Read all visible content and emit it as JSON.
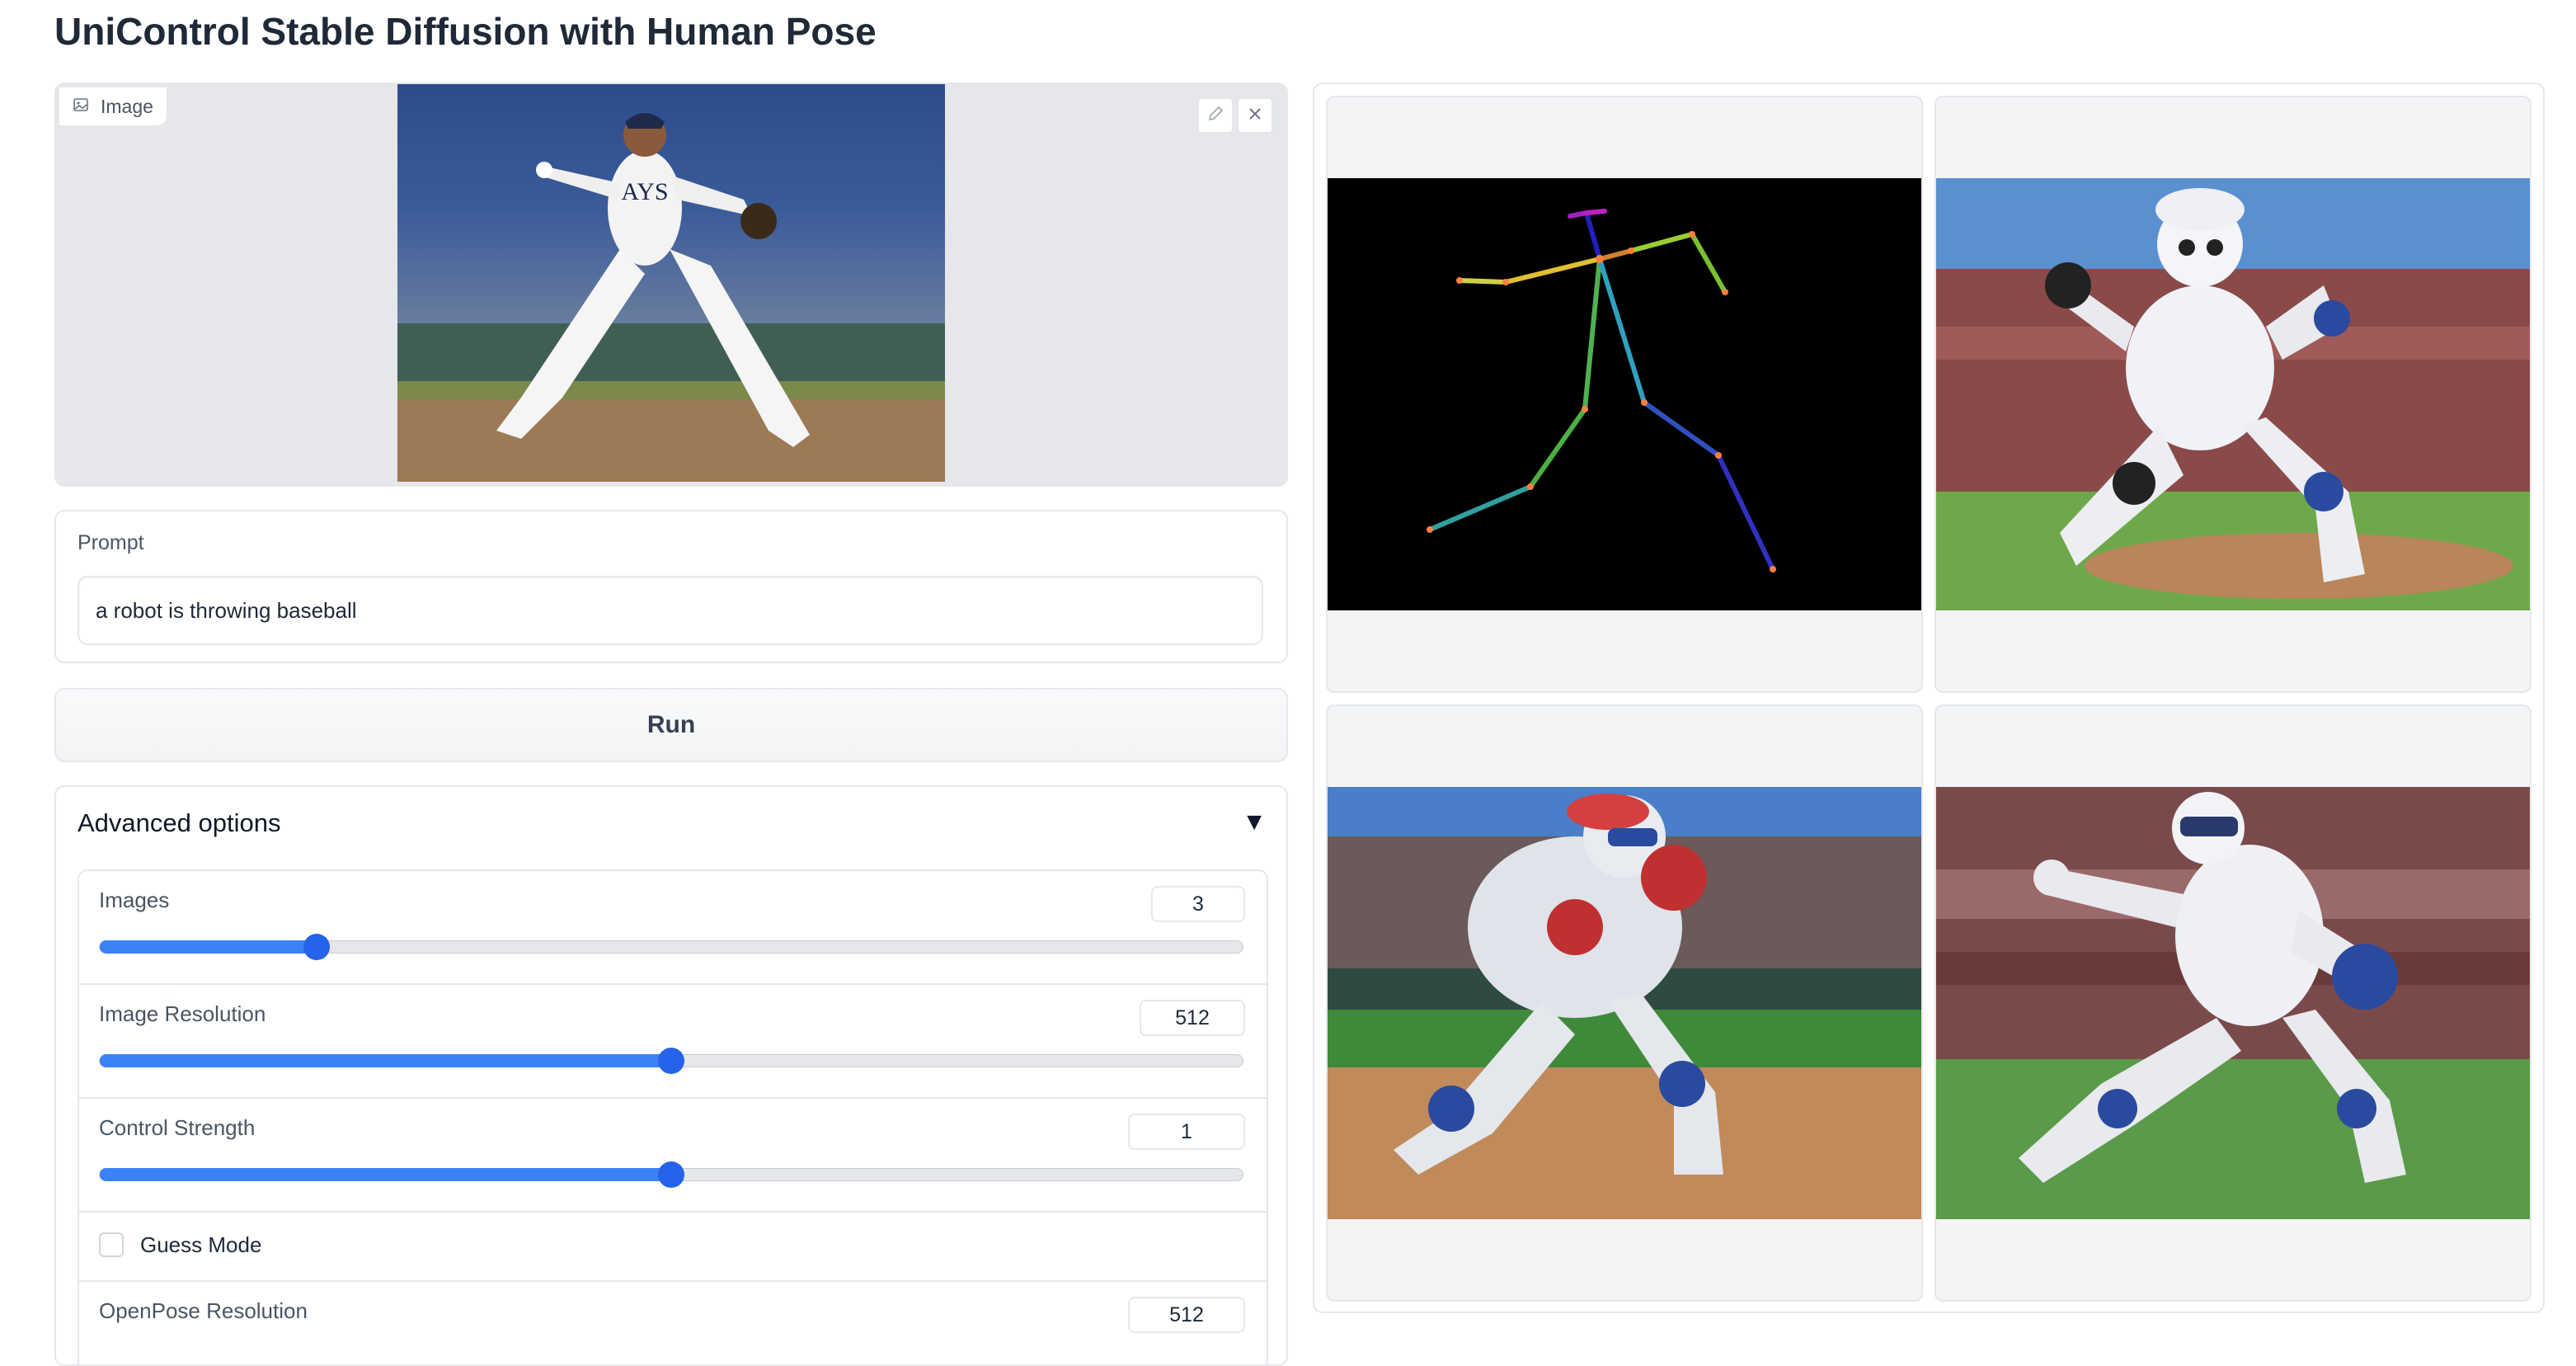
{
  "page": {
    "title": "UniControl Stable Diffusion with Human Pose"
  },
  "input_image": {
    "label": "Image",
    "label_icon": "image-icon",
    "edit_icon": "pencil-icon",
    "clear_icon": "close-icon",
    "caption": "baseball pitcher photo"
  },
  "prompt": {
    "label": "Prompt",
    "value": "a robot is throwing baseball"
  },
  "run": {
    "label": "Run"
  },
  "advanced": {
    "title": "Advanced options",
    "toggle_glyph": "▼",
    "sliders": [
      {
        "label": "Images",
        "value": "3",
        "fraction": 0.19
      },
      {
        "label": "Image Resolution",
        "value": "512",
        "fraction": 0.5
      },
      {
        "label": "Control Strength",
        "value": "1",
        "fraction": 0.5
      }
    ],
    "guess_mode": {
      "label": "Guess Mode",
      "checked": false
    },
    "openpose": {
      "label": "OpenPose Resolution",
      "value": "512"
    }
  },
  "gallery": {
    "items": [
      {
        "kind": "pose-skeleton"
      },
      {
        "kind": "robot-pitcher-1"
      },
      {
        "kind": "robot-pitcher-2"
      },
      {
        "kind": "robot-pitcher-3"
      }
    ]
  },
  "colors": {
    "accent": "#3b82f6",
    "thumb": "#2563eb",
    "border": "#e5e7eb",
    "panel_bg": "#f3f4f6"
  }
}
